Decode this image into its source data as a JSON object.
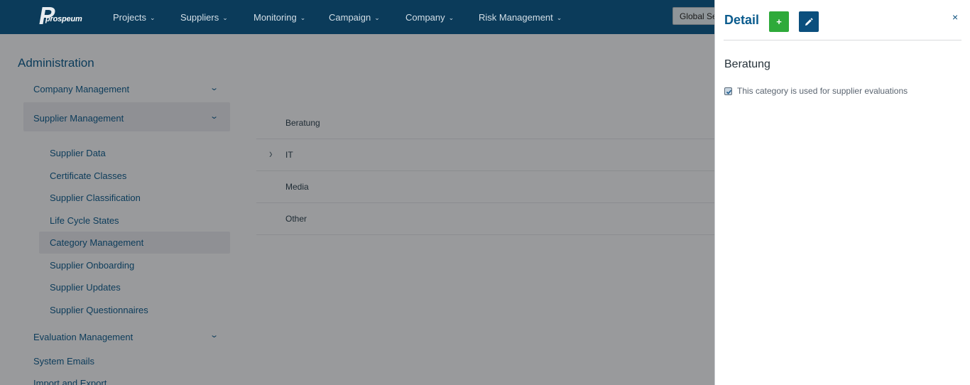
{
  "app": {
    "logo_text": "prospeum",
    "nav": [
      {
        "label": "Projects"
      },
      {
        "label": "Suppliers"
      },
      {
        "label": "Monitoring"
      },
      {
        "label": "Campaign"
      },
      {
        "label": "Company"
      },
      {
        "label": "Risk Management"
      }
    ],
    "global_search_placeholder": "Global Se"
  },
  "sidebar": {
    "title": "Administration",
    "groups": [
      {
        "label": "Company Management"
      },
      {
        "label": "Supplier Management"
      },
      {
        "label": "Evaluation Management"
      },
      {
        "label": "System Emails"
      },
      {
        "label": "Import and Export"
      }
    ],
    "supplier_items": [
      {
        "label": "Supplier Data"
      },
      {
        "label": "Certificate Classes"
      },
      {
        "label": "Supplier Classification"
      },
      {
        "label": "Life Cycle States"
      },
      {
        "label": "Category Management"
      },
      {
        "label": "Supplier Onboarding"
      },
      {
        "label": "Supplier Updates"
      },
      {
        "label": "Supplier Questionnaires"
      }
    ],
    "active_item": "Category Management"
  },
  "categories": [
    {
      "label": "Beratung",
      "expandable": false
    },
    {
      "label": "IT",
      "expandable": true
    },
    {
      "label": "Media",
      "expandable": false
    },
    {
      "label": "Other",
      "expandable": false
    }
  ],
  "detail": {
    "title": "Detail",
    "add_label": "+",
    "close_label": "×",
    "name": "Beratung",
    "checkbox_label": "This category is used for supplier evaluations",
    "checkbox_checked": true
  },
  "colors": {
    "nav_bg": "#0b3b5a",
    "add_button": "#2eaa3a",
    "edit_button": "#0b4f7d",
    "detail_title": "#0b5c8e"
  }
}
